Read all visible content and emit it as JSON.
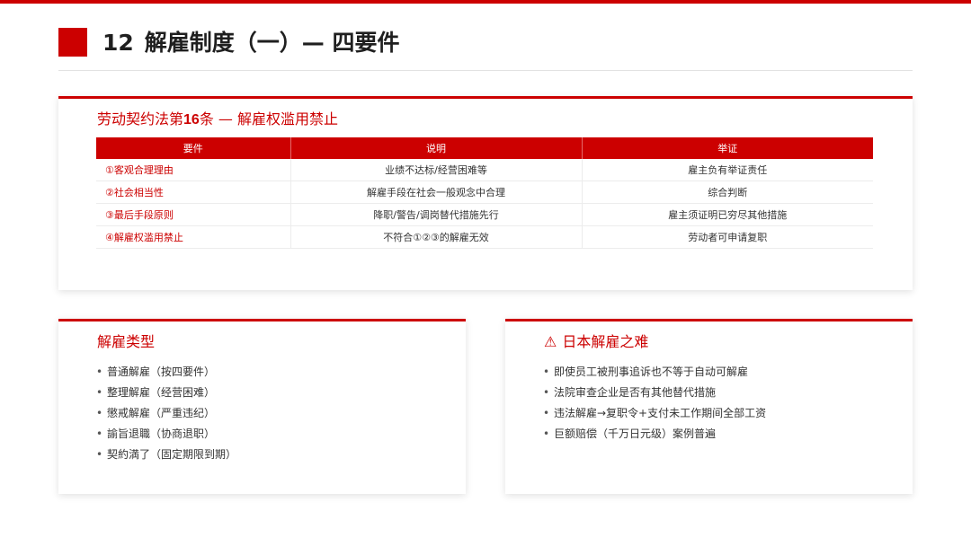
{
  "colors": {
    "accent": "#cc0000",
    "text": "#333333"
  },
  "title": {
    "number": "12",
    "text": "解雇制度（一）— 四要件"
  },
  "main_card": {
    "heading_prefix": "劳动契约法第",
    "heading_number": "16",
    "heading_suffix": "条 — 解雇权滥用禁止",
    "table": {
      "headers": [
        "要件",
        "说明",
        "举证"
      ],
      "rows": [
        [
          "①客观合理理由",
          "业绩不达标/经营困难等",
          "雇主负有举证责任"
        ],
        [
          "②社会相当性",
          "解雇手段在社会一般观念中合理",
          "综合判断"
        ],
        [
          "③最后手段原则",
          "降职/警告/调岗替代措施先行",
          "雇主须证明已穷尽其他措施"
        ],
        [
          "④解雇权滥用禁止",
          "不符合①②③的解雇无效",
          "劳动者可申请复职"
        ]
      ]
    }
  },
  "left_card": {
    "heading": "解雇类型",
    "bullet": "•",
    "items": [
      "普通解雇（按四要件）",
      "整理解雇（经营困难）",
      "懲戒解雇（严重违纪）",
      "諭旨退職（协商退职）",
      "契約満了（固定期限到期）"
    ]
  },
  "right_card": {
    "icon": "⚠",
    "icon_name": "warning-icon",
    "heading": "日本解雇之难",
    "bullet": "•",
    "items": [
      "即使员工被刑事追诉也不等于自动可解雇",
      "法院审查企业是否有其他替代措施",
      "违法解雇→复职令+支付未工作期间全部工资",
      "巨额赔偿（千万日元级）案例普遍"
    ]
  }
}
